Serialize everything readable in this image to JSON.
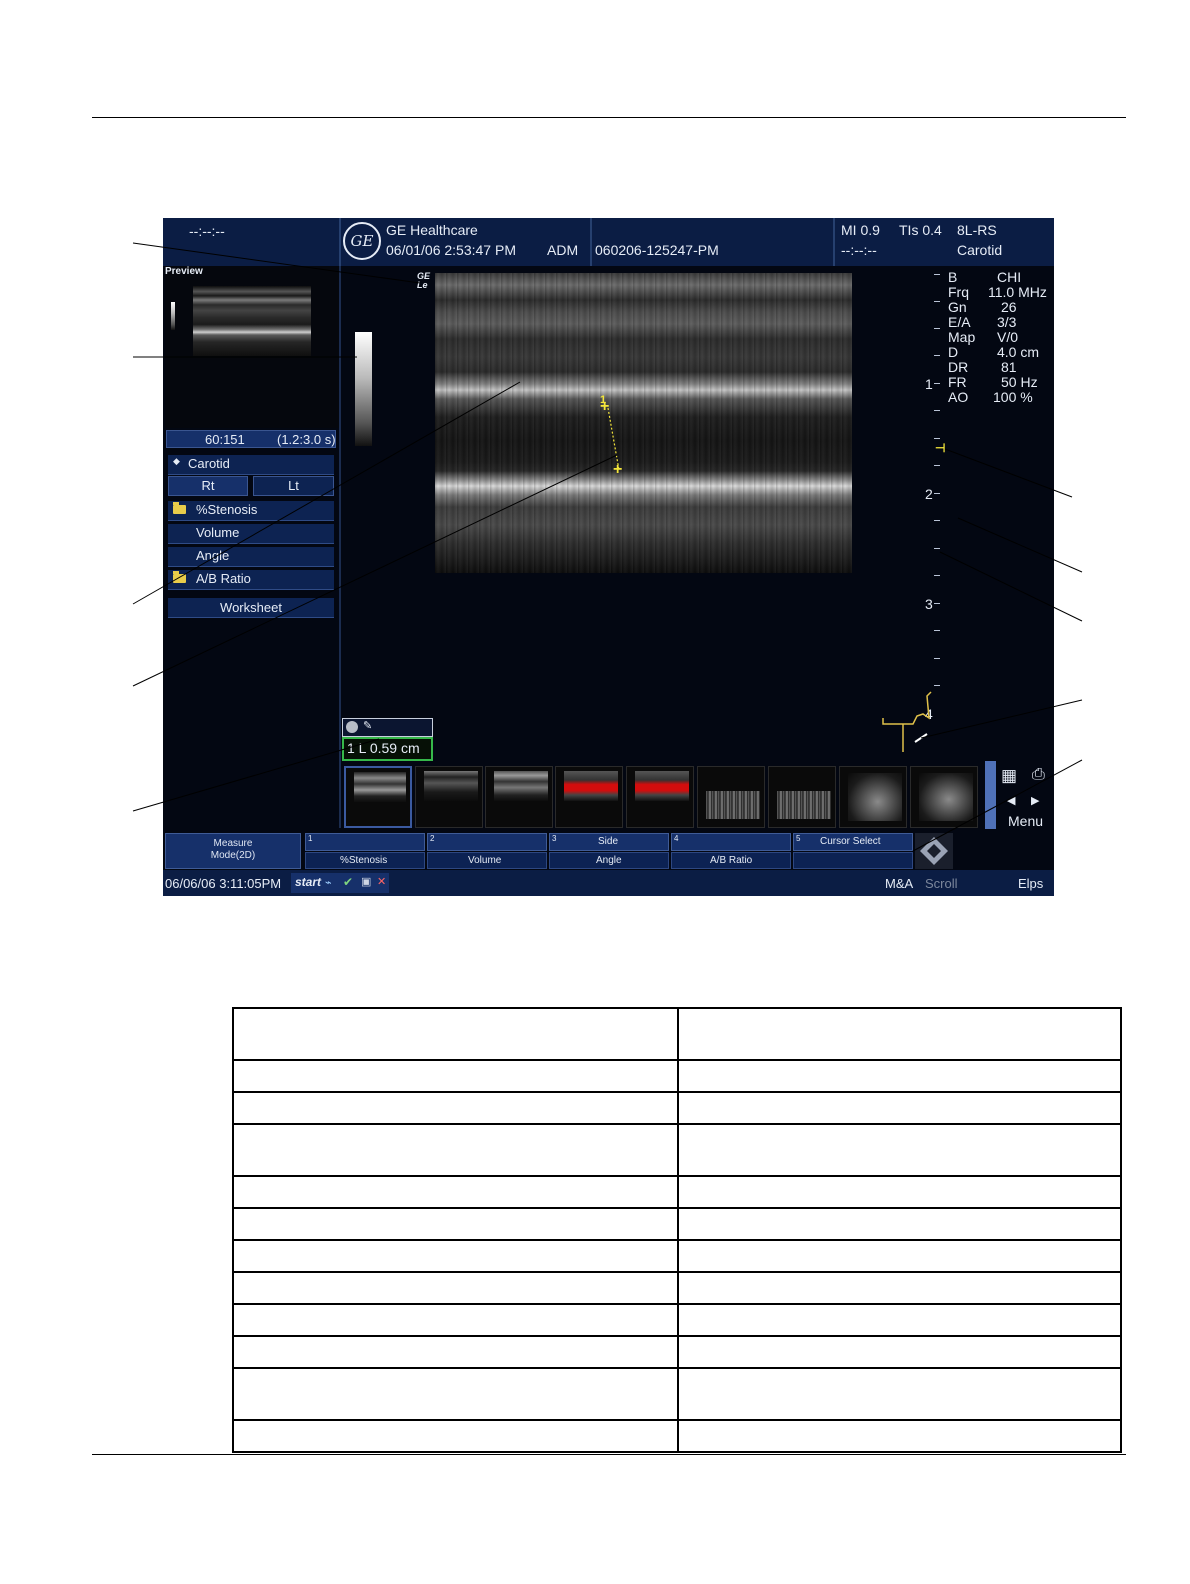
{
  "screen": {
    "header": {
      "left_time": "--:--:--",
      "company": "GE Healthcare",
      "datetime": "06/01/06 2:53:47 PM",
      "operator": "ADM",
      "patient_id": "060206-125247-PM",
      "mi": "MI 0.9",
      "tis": "TIs 0.4",
      "probe": "8L-RS",
      "right_time": "--:--:--",
      "application": "Carotid",
      "logo_text": "GE"
    },
    "preview": {
      "title": "Preview",
      "frame_counter": "60:151",
      "cine_time": "(1.2:3.0 s)"
    },
    "probe_orientation_mark": "GE\nLe",
    "measurement_menu": {
      "category": "Carotid",
      "side_right": "Rt",
      "side_left": "Lt",
      "items": [
        {
          "label": "%Stenosis",
          "folder": true
        },
        {
          "label": "Volume",
          "folder": false
        },
        {
          "label": "Angle",
          "folder": false
        },
        {
          "label": "A/B Ratio",
          "folder": true
        }
      ],
      "worksheet": "Worksheet"
    },
    "imaging_params": [
      {
        "name": "B",
        "value": "CHI"
      },
      {
        "name": "Frq",
        "value": "11.0 MHz"
      },
      {
        "name": "Gn",
        "value": "26"
      },
      {
        "name": "E/A",
        "value": "3/3"
      },
      {
        "name": "Map",
        "value": "V/0"
      },
      {
        "name": "D",
        "value": "4.0 cm"
      },
      {
        "name": "DR",
        "value": "81"
      },
      {
        "name": "FR",
        "value": "50 Hz"
      },
      {
        "name": "AO",
        "value": "100 %"
      }
    ],
    "depth_scale": [
      "1",
      "2",
      "3",
      "4"
    ],
    "caliper_labels": [
      "1",
      "+"
    ],
    "measurement_result": "1 L 0.59 cm",
    "clipboard": {
      "menu_label": "Menu",
      "thumbnails": [
        {
          "kind": "bmode"
        },
        {
          "kind": "bmode"
        },
        {
          "kind": "bmode"
        },
        {
          "kind": "color"
        },
        {
          "kind": "color"
        },
        {
          "kind": "doppler"
        },
        {
          "kind": "doppler"
        },
        {
          "kind": "abdomen"
        },
        {
          "kind": "abdomen"
        }
      ]
    },
    "soft_menu": {
      "mode_label": "Measure\nMode(2D)",
      "top_row": [
        {
          "num": "1",
          "label": ""
        },
        {
          "num": "2",
          "label": ""
        },
        {
          "num": "3",
          "label": "Side"
        },
        {
          "num": "4",
          "label": ""
        },
        {
          "num": "5",
          "label": "Cursor Select"
        }
      ],
      "bottom_row": [
        "%Stenosis",
        "Volume",
        "Angle",
        "A/B Ratio",
        ""
      ]
    },
    "status_bar": {
      "datetime": "06/06/06 3:11:05PM",
      "start": "start",
      "trackball_functions": [
        "M&A",
        "Scroll",
        "Elps"
      ]
    }
  },
  "table": {
    "rows": [
      [
        "",
        ""
      ],
      [
        "",
        ""
      ],
      [
        "",
        ""
      ],
      [
        "",
        ""
      ],
      [
        "",
        ""
      ],
      [
        "",
        ""
      ],
      [
        "",
        ""
      ],
      [
        "",
        ""
      ],
      [
        "",
        ""
      ],
      [
        "",
        ""
      ],
      [
        "",
        ""
      ],
      [
        "",
        ""
      ]
    ]
  }
}
